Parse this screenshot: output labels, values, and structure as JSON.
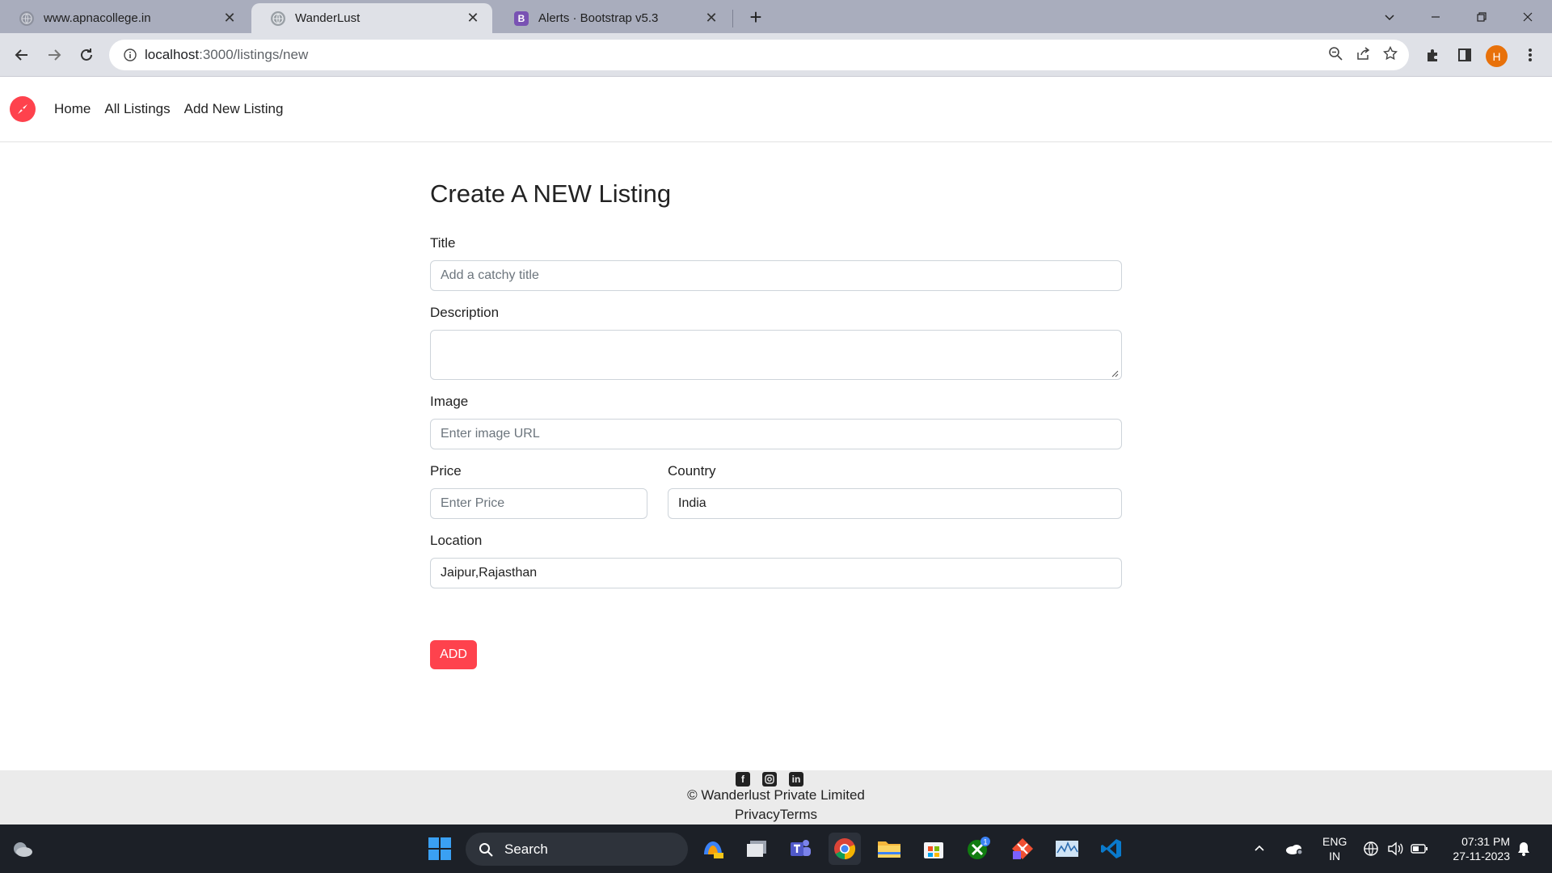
{
  "browser": {
    "tabs": [
      {
        "label": "www.apnacollege.in"
      },
      {
        "label": "WanderLust"
      },
      {
        "label": "Alerts · Bootstrap v5.3"
      }
    ],
    "url_host": "localhost",
    "url_rest": ":3000/listings/new",
    "profile_initial": "H"
  },
  "navbar": {
    "links": [
      "Home",
      "All Listings",
      "Add New Listing"
    ]
  },
  "form": {
    "heading": "Create A NEW Listing",
    "title": {
      "label": "Title",
      "placeholder": "Add a catchy title"
    },
    "description": {
      "label": "Description",
      "value": ""
    },
    "image": {
      "label": "Image",
      "placeholder": "Enter image URL"
    },
    "price": {
      "label": "Price",
      "placeholder": "Enter Price"
    },
    "country": {
      "label": "Country",
      "value": "India"
    },
    "location": {
      "label": "Location",
      "value": "Jaipur,Rajasthan"
    },
    "submit_label": "ADD"
  },
  "footer": {
    "copyright": "© Wanderlust Private Limited",
    "links": "PrivacyTerms",
    "socials": [
      "facebook-icon",
      "instagram-icon",
      "linkedin-icon"
    ]
  },
  "taskbar": {
    "search_label": "Search",
    "lang_line1": "ENG",
    "lang_line2": "IN",
    "time": "07:31 PM",
    "date": "27-11-2023",
    "badge_count": "1"
  },
  "colors": {
    "brand": "#fe424d",
    "tabstrip": "#a9adbd",
    "toolbar": "#dfe1e7",
    "footer": "#ebebeb",
    "taskbar": "#1c2027"
  }
}
